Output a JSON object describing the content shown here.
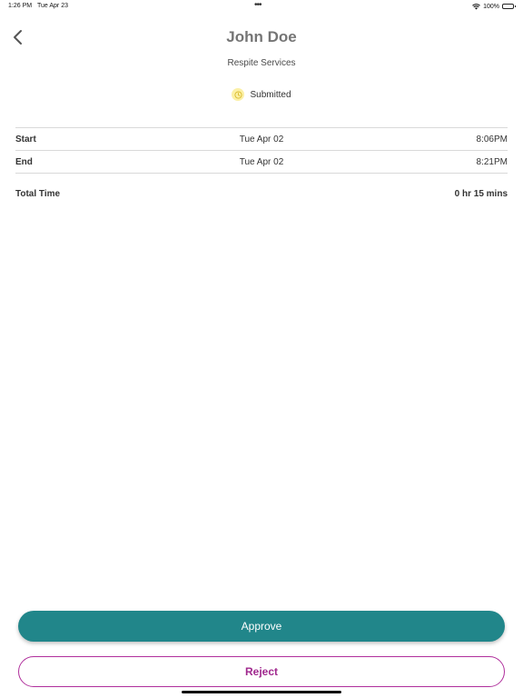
{
  "status_bar": {
    "time": "1:26 PM",
    "date": "Tue Apr 23",
    "dots": "•••",
    "battery": "100%"
  },
  "header": {
    "title": "John Doe",
    "subtitle": "Respite Services",
    "status": "Submitted",
    "status_color": "#fbf0a6"
  },
  "times": {
    "rows": [
      {
        "label": "Start",
        "date": "Tue Apr 02",
        "time": "8:06PM"
      },
      {
        "label": "End",
        "date": "Tue Apr 02",
        "time": "8:21PM"
      }
    ],
    "total_label": "Total Time",
    "total_value": "0 hr 15 mins"
  },
  "actions": {
    "approve_label": "Approve",
    "reject_label": "Reject",
    "approve_color": "#21868a",
    "reject_color": "#a0288e"
  },
  "icons": {
    "back": "chevron-left-icon",
    "status": "clock-icon",
    "wifi": "wifi-icon",
    "battery": "battery-icon"
  }
}
